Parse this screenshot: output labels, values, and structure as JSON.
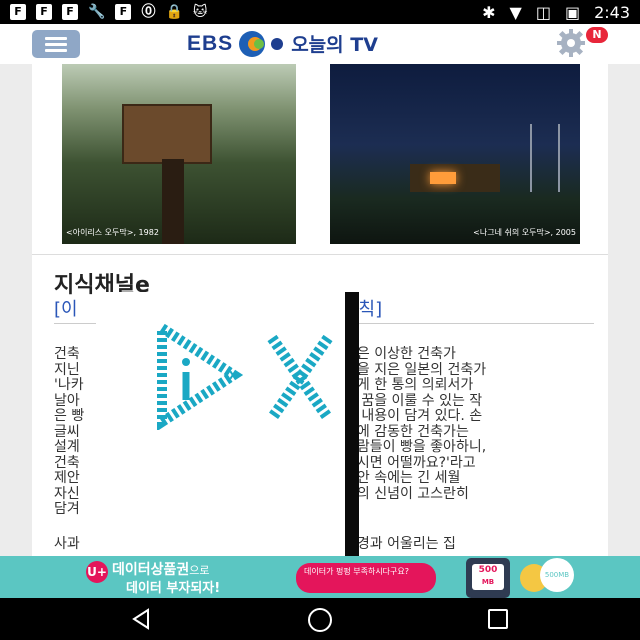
{
  "status_bar": {
    "left_icons": [
      "F",
      "F",
      "F",
      "🔧",
      "F",
      "⓪",
      "🔒",
      "🐱"
    ],
    "right_icons": [
      "✱",
      "▼",
      "◫",
      "▣"
    ],
    "time": "2:43"
  },
  "app_bar": {
    "logo_ebs": "EBS",
    "logo_tv": "오늘의 TV",
    "notification_badge": "N"
  },
  "photos": {
    "caption_left": "<아이리스 오두막>, 1982",
    "caption_right": "<나그네 쉬의 오두막>, 2005"
  },
  "article": {
    "title": "지식채널e",
    "subtitle_left": "[이",
    "subtitle_right": "원칙]",
    "body_left": [
      "건축",
      "지닌",
      "'나카",
      "날아",
      "은 빵",
      "글씨",
      "설계",
      "건축",
      "제안",
      "자신",
      "담겨"
    ],
    "body_right": [
      "같은 이상한 건축가",
      "현을 지은 일본의 건축가",
      "에게 한 통의 의뢰서가",
      "의 꿈을 이룰 수 있는 작",
      "란 내용이 담겨 있다. 손",
      "지에 감동한 건축가는",
      "사람들이 빵을 좋아하니,",
      "주시면 어떨까요?'라고",
      "제안 속에는 긴 세월",
      "가의 신념이 고스란히",
      ""
    ],
    "body_bottom_left": "사과",
    "body_bottom_right": "풍경과 어울리는 집"
  },
  "banner": {
    "logo": "U+",
    "line1_bold": "데이터상품권",
    "line1_suffix": "으로",
    "line2": "데이터 부자되자!",
    "bubble": "데이터가 펑펑 부족하시다구요?",
    "phone_value": "500",
    "phone_unit": "MB",
    "coin_label": "500MB"
  },
  "colors": {
    "brand_blue": "#1e3e8f",
    "link_blue": "#2a56b8",
    "banner_teal": "#5bc6c2",
    "accent_pink": "#e4155b"
  }
}
